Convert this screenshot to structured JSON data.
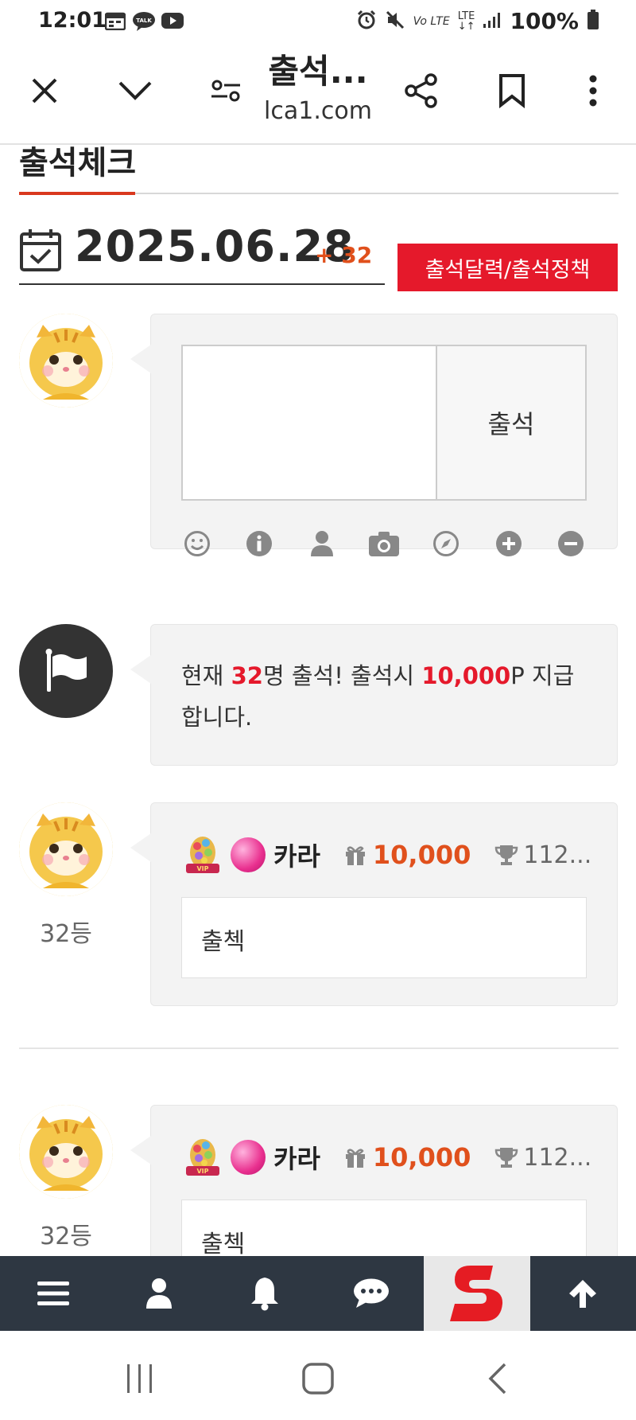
{
  "status_bar": {
    "time": "12:01",
    "battery": "100%"
  },
  "toolbar": {
    "title": "출석...",
    "url": "lca1.com"
  },
  "page": {
    "tab_label": "출석체크",
    "date": "2025.06.28",
    "count": "+ 32",
    "policy_button": "출석달력/출석정책"
  },
  "comment_form": {
    "submit_label": "출석"
  },
  "notice": {
    "prefix": "현재 ",
    "count": "32",
    "mid": "명 출석! 출석시 ",
    "points": "10,000",
    "suffix": "P 지급 합니다."
  },
  "entries": [
    {
      "rank": "32등",
      "name": "카라",
      "points": "10,000",
      "trophy": "112...",
      "message": "출첵"
    },
    {
      "rank": "32등",
      "name": "카라",
      "points": "10,000",
      "trophy": "112...",
      "message": "출첵"
    }
  ],
  "colors": {
    "accent_red": "#e5192b",
    "accent_orange": "#e0501c",
    "nav_bg": "#2e3742"
  }
}
